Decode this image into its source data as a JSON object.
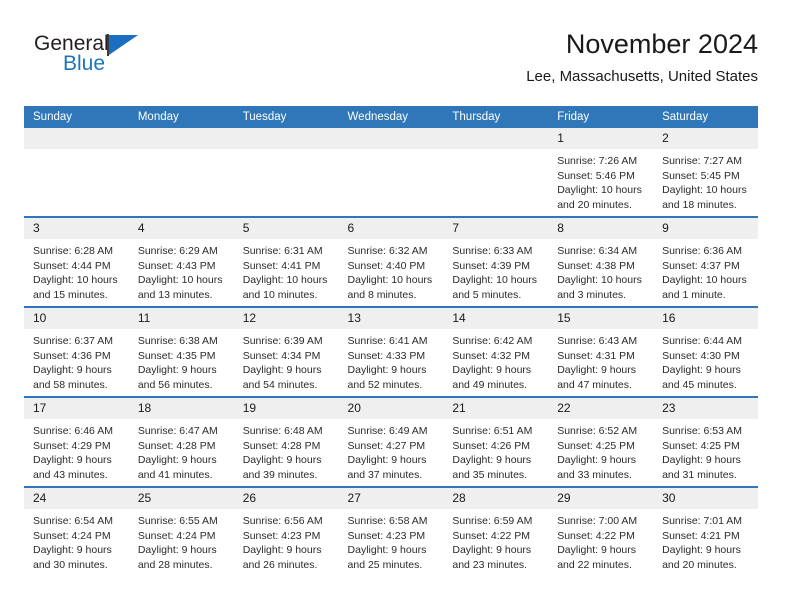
{
  "brand": {
    "name_part1": "General",
    "name_part2": "Blue",
    "flag_icon": "triangle-flag-icon"
  },
  "header": {
    "month_title": "November 2024",
    "location": "Lee, Massachusetts, United States"
  },
  "colors": {
    "header_blue": "#2f77b8",
    "brand_blue": "#1b75bb",
    "daynum_band": "#efefef",
    "text": "#2b2b2b"
  },
  "calendar": {
    "weekday_headers": [
      "Sunday",
      "Monday",
      "Tuesday",
      "Wednesday",
      "Thursday",
      "Friday",
      "Saturday"
    ],
    "weeks": [
      [
        {
          "day": "",
          "blank": true
        },
        {
          "day": "",
          "blank": true
        },
        {
          "day": "",
          "blank": true
        },
        {
          "day": "",
          "blank": true
        },
        {
          "day": "",
          "blank": true
        },
        {
          "day": "1",
          "sunrise": "Sunrise: 7:26 AM",
          "sunset": "Sunset: 5:46 PM",
          "daylight": "Daylight: 10 hours and 20 minutes."
        },
        {
          "day": "2",
          "sunrise": "Sunrise: 7:27 AM",
          "sunset": "Sunset: 5:45 PM",
          "daylight": "Daylight: 10 hours and 18 minutes."
        }
      ],
      [
        {
          "day": "3",
          "sunrise": "Sunrise: 6:28 AM",
          "sunset": "Sunset: 4:44 PM",
          "daylight": "Daylight: 10 hours and 15 minutes."
        },
        {
          "day": "4",
          "sunrise": "Sunrise: 6:29 AM",
          "sunset": "Sunset: 4:43 PM",
          "daylight": "Daylight: 10 hours and 13 minutes."
        },
        {
          "day": "5",
          "sunrise": "Sunrise: 6:31 AM",
          "sunset": "Sunset: 4:41 PM",
          "daylight": "Daylight: 10 hours and 10 minutes."
        },
        {
          "day": "6",
          "sunrise": "Sunrise: 6:32 AM",
          "sunset": "Sunset: 4:40 PM",
          "daylight": "Daylight: 10 hours and 8 minutes."
        },
        {
          "day": "7",
          "sunrise": "Sunrise: 6:33 AM",
          "sunset": "Sunset: 4:39 PM",
          "daylight": "Daylight: 10 hours and 5 minutes."
        },
        {
          "day": "8",
          "sunrise": "Sunrise: 6:34 AM",
          "sunset": "Sunset: 4:38 PM",
          "daylight": "Daylight: 10 hours and 3 minutes."
        },
        {
          "day": "9",
          "sunrise": "Sunrise: 6:36 AM",
          "sunset": "Sunset: 4:37 PM",
          "daylight": "Daylight: 10 hours and 1 minute."
        }
      ],
      [
        {
          "day": "10",
          "sunrise": "Sunrise: 6:37 AM",
          "sunset": "Sunset: 4:36 PM",
          "daylight": "Daylight: 9 hours and 58 minutes."
        },
        {
          "day": "11",
          "sunrise": "Sunrise: 6:38 AM",
          "sunset": "Sunset: 4:35 PM",
          "daylight": "Daylight: 9 hours and 56 minutes."
        },
        {
          "day": "12",
          "sunrise": "Sunrise: 6:39 AM",
          "sunset": "Sunset: 4:34 PM",
          "daylight": "Daylight: 9 hours and 54 minutes."
        },
        {
          "day": "13",
          "sunrise": "Sunrise: 6:41 AM",
          "sunset": "Sunset: 4:33 PM",
          "daylight": "Daylight: 9 hours and 52 minutes."
        },
        {
          "day": "14",
          "sunrise": "Sunrise: 6:42 AM",
          "sunset": "Sunset: 4:32 PM",
          "daylight": "Daylight: 9 hours and 49 minutes."
        },
        {
          "day": "15",
          "sunrise": "Sunrise: 6:43 AM",
          "sunset": "Sunset: 4:31 PM",
          "daylight": "Daylight: 9 hours and 47 minutes."
        },
        {
          "day": "16",
          "sunrise": "Sunrise: 6:44 AM",
          "sunset": "Sunset: 4:30 PM",
          "daylight": "Daylight: 9 hours and 45 minutes."
        }
      ],
      [
        {
          "day": "17",
          "sunrise": "Sunrise: 6:46 AM",
          "sunset": "Sunset: 4:29 PM",
          "daylight": "Daylight: 9 hours and 43 minutes."
        },
        {
          "day": "18",
          "sunrise": "Sunrise: 6:47 AM",
          "sunset": "Sunset: 4:28 PM",
          "daylight": "Daylight: 9 hours and 41 minutes."
        },
        {
          "day": "19",
          "sunrise": "Sunrise: 6:48 AM",
          "sunset": "Sunset: 4:28 PM",
          "daylight": "Daylight: 9 hours and 39 minutes."
        },
        {
          "day": "20",
          "sunrise": "Sunrise: 6:49 AM",
          "sunset": "Sunset: 4:27 PM",
          "daylight": "Daylight: 9 hours and 37 minutes."
        },
        {
          "day": "21",
          "sunrise": "Sunrise: 6:51 AM",
          "sunset": "Sunset: 4:26 PM",
          "daylight": "Daylight: 9 hours and 35 minutes."
        },
        {
          "day": "22",
          "sunrise": "Sunrise: 6:52 AM",
          "sunset": "Sunset: 4:25 PM",
          "daylight": "Daylight: 9 hours and 33 minutes."
        },
        {
          "day": "23",
          "sunrise": "Sunrise: 6:53 AM",
          "sunset": "Sunset: 4:25 PM",
          "daylight": "Daylight: 9 hours and 31 minutes."
        }
      ],
      [
        {
          "day": "24",
          "sunrise": "Sunrise: 6:54 AM",
          "sunset": "Sunset: 4:24 PM",
          "daylight": "Daylight: 9 hours and 30 minutes."
        },
        {
          "day": "25",
          "sunrise": "Sunrise: 6:55 AM",
          "sunset": "Sunset: 4:24 PM",
          "daylight": "Daylight: 9 hours and 28 minutes."
        },
        {
          "day": "26",
          "sunrise": "Sunrise: 6:56 AM",
          "sunset": "Sunset: 4:23 PM",
          "daylight": "Daylight: 9 hours and 26 minutes."
        },
        {
          "day": "27",
          "sunrise": "Sunrise: 6:58 AM",
          "sunset": "Sunset: 4:23 PM",
          "daylight": "Daylight: 9 hours and 25 minutes."
        },
        {
          "day": "28",
          "sunrise": "Sunrise: 6:59 AM",
          "sunset": "Sunset: 4:22 PM",
          "daylight": "Daylight: 9 hours and 23 minutes."
        },
        {
          "day": "29",
          "sunrise": "Sunrise: 7:00 AM",
          "sunset": "Sunset: 4:22 PM",
          "daylight": "Daylight: 9 hours and 22 minutes."
        },
        {
          "day": "30",
          "sunrise": "Sunrise: 7:01 AM",
          "sunset": "Sunset: 4:21 PM",
          "daylight": "Daylight: 9 hours and 20 minutes."
        }
      ]
    ]
  }
}
